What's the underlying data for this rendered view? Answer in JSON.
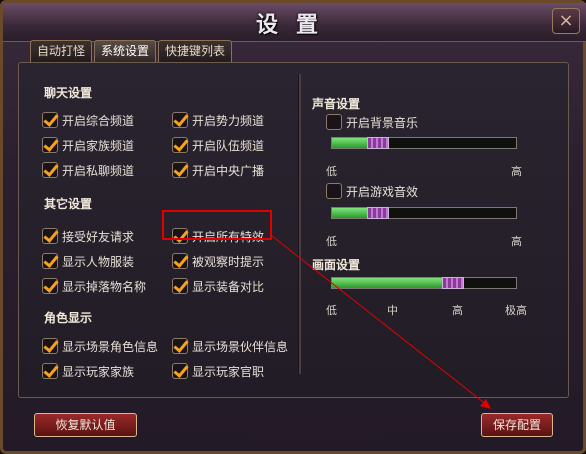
{
  "window": {
    "title": "设置",
    "close_label": "×"
  },
  "tabs": [
    {
      "label": "自动打怪",
      "active": false
    },
    {
      "label": "系统设置",
      "active": true
    },
    {
      "label": "快捷键列表",
      "active": false
    }
  ],
  "chat": {
    "heading": "聊天设置",
    "items": [
      {
        "label": "开启综合频道",
        "checked": true
      },
      {
        "label": "开启势力频道",
        "checked": true
      },
      {
        "label": "开启家族频道",
        "checked": true
      },
      {
        "label": "开启队伍频道",
        "checked": true
      },
      {
        "label": "开启私聊频道",
        "checked": true
      },
      {
        "label": "开启中央广播",
        "checked": true
      }
    ]
  },
  "other": {
    "heading": "其它设置",
    "items": [
      {
        "label": "接受好友请求",
        "checked": true
      },
      {
        "label": "开启所有特效",
        "checked": true
      },
      {
        "label": "显示人物服装",
        "checked": true
      },
      {
        "label": "被观察时提示",
        "checked": true
      },
      {
        "label": "显示掉落物名称",
        "checked": true
      },
      {
        "label": "显示装备对比",
        "checked": true
      }
    ]
  },
  "role": {
    "heading": "角色显示",
    "items": [
      {
        "label": "显示场景角色信息",
        "checked": true
      },
      {
        "label": "显示场景伙伴信息",
        "checked": true
      },
      {
        "label": "显示玩家家族",
        "checked": true
      },
      {
        "label": "显示玩家官职",
        "checked": true
      }
    ]
  },
  "sound": {
    "heading": "声音设置",
    "bgm": {
      "label": "开启背景音乐",
      "checked": false,
      "level": 0.25
    },
    "sfx": {
      "label": "开启游戏音效",
      "checked": false,
      "level": 0.25
    },
    "low": "低",
    "high": "高"
  },
  "display": {
    "heading": "画面设置",
    "level": 0.66,
    "ticks": [
      "低",
      "中",
      "高",
      "极高"
    ]
  },
  "buttons": {
    "reset": "恢复默认值",
    "save": "保存配置"
  },
  "colors": {
    "check": "#f7a21b",
    "slider_fill": "#2c9a2a",
    "thumb": "#a050b8",
    "button": "#8a2020",
    "highlight": "#e00000"
  }
}
